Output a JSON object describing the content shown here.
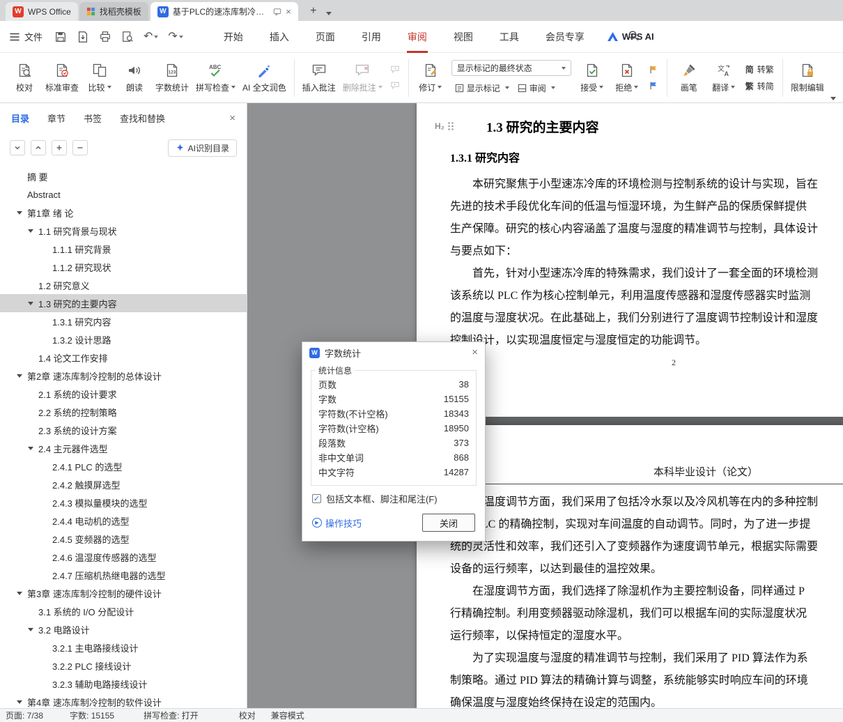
{
  "window": {
    "tab_wps": "WPS Office",
    "tab_template": "找稻壳模板",
    "tab_document": "基于PLC的速冻库制冷控制系...",
    "file_menu": "文件",
    "menu_tabs": [
      "开始",
      "插入",
      "页面",
      "引用",
      "审阅",
      "视图",
      "工具",
      "会员专享"
    ],
    "wps_ai": "WPS AI"
  },
  "icons": {
    "w": "W",
    "h2": "H₂",
    "jian": "简",
    "fan": "繁"
  },
  "ribbon": {
    "proofread": "校对",
    "standard_review": "标准审查",
    "compare": "比较",
    "read_aloud": "朗读",
    "word_count": "字数统计",
    "spell_check": "拼写检查",
    "ai_polish": "AI 全文润色",
    "insert_comment": "插入批注",
    "delete_comment": "删除批注",
    "track_changes": "修订",
    "markup_state": "显示标记的最终状态",
    "show_markup": "显示标记",
    "review_pane": "审阅",
    "accept": "接受",
    "reject": "拒绝",
    "brush": "画笔",
    "translate": "翻译",
    "to_traditional": "转繁",
    "to_simplified": "转简",
    "restrict_edit": "限制编辑"
  },
  "sidebar": {
    "tabs": [
      "目录",
      "章节",
      "书签",
      "查找和替换"
    ],
    "ai_toc": "AI识别目录",
    "toc": [
      {
        "level": 0,
        "label": "摘  要"
      },
      {
        "level": 0,
        "label": "Abstract"
      },
      {
        "level": 0,
        "label": "第1章 绪  论",
        "arrow": true
      },
      {
        "level": 1,
        "label": "1.1 研究背景与现状",
        "arrow": true
      },
      {
        "level": 2,
        "label": "1.1.1 研究背景"
      },
      {
        "level": 2,
        "label": "1.1.2 研究现状"
      },
      {
        "level": 1,
        "label": "1.2 研究意义"
      },
      {
        "level": 1,
        "label": "1.3 研究的主要内容",
        "arrow": true,
        "selected": true
      },
      {
        "level": 2,
        "label": "1.3.1 研究内容"
      },
      {
        "level": 2,
        "label": "1.3.2 设计思路"
      },
      {
        "level": 1,
        "label": "1.4 论文工作安排"
      },
      {
        "level": 0,
        "label": "第2章 速冻库制冷控制的总体设计",
        "arrow": true
      },
      {
        "level": 1,
        "label": "2.1 系统的设计要求"
      },
      {
        "level": 1,
        "label": "2.2 系统的控制策略"
      },
      {
        "level": 1,
        "label": "2.3 系统的设计方案"
      },
      {
        "level": 1,
        "label": "2.4 主元器件选型",
        "arrow": true
      },
      {
        "level": 2,
        "label": "2.4.1 PLC 的选型"
      },
      {
        "level": 2,
        "label": "2.4.2 触摸屏选型"
      },
      {
        "level": 2,
        "label": "2.4.3 模拟量模块的选型"
      },
      {
        "level": 2,
        "label": "2.4.4 电动机的选型"
      },
      {
        "level": 2,
        "label": "2.4.5 变频器的选型"
      },
      {
        "level": 2,
        "label": "2.4.6 温湿度传感器的选型"
      },
      {
        "level": 2,
        "label": "2.4.7 压缩机热继电器的选型"
      },
      {
        "level": 0,
        "label": "第3章 速冻库制冷控制的硬件设计",
        "arrow": true
      },
      {
        "level": 1,
        "label": "3.1 系统的 I/O 分配设计"
      },
      {
        "level": 1,
        "label": "3.2 电路设计",
        "arrow": true
      },
      {
        "level": 2,
        "label": "3.2.1 主电路接线设计"
      },
      {
        "level": 2,
        "label": "3.2.2 PLC 接线设计"
      },
      {
        "level": 2,
        "label": "3.2.3 辅助电路接线设计"
      },
      {
        "level": 0,
        "label": "第4章 速冻库制冷控制的软件设计",
        "arrow": true
      }
    ]
  },
  "document": {
    "page1": {
      "heading2": "1.3  研究的主要内容",
      "heading3": "1.3.1 研究内容",
      "lines": [
        "　　本研究聚焦于小型速冻冷库的环境检测与控制系统的设计与实现，旨在",
        "先进的技术手段优化车间的低温与恒湿环境，为生鲜产品的保质保鲜提供",
        "生产保障。研究的核心内容涵盖了温度与湿度的精准调节与控制，具体设计",
        "与要点如下：",
        "　　首先，针对小型速冻冷库的特殊需求，我们设计了一套全面的环境检测",
        "该系统以 PLC 作为核心控制单元，利用温度传感器和湿度传感器实时监测",
        "的温度与湿度状况。在此基础上，我们分别进行了温度调节控制设计和湿度",
        "控制设计，以实现温度恒定与湿度恒定的功能调节。"
      ],
      "page_number": "2"
    },
    "page2": {
      "header": "本科毕业设计（论文）",
      "lines": [
        "　　在温度调节方面，我们采用了包括冷水泵以及冷风机等在内的多种控制",
        "通过 PLC 的精确控制，实现对车间温度的自动调节。同时，为了进一步提",
        "统的灵活性和效率，我们还引入了变频器作为速度调节单元，根据实际需要",
        "设备的运行频率，以达到最佳的温控效果。",
        "　　在湿度调节方面，我们选择了除湿机作为主要控制设备，同样通过 P",
        "行精确控制。利用变频器驱动除湿机，我们可以根据车间的实际湿度状况",
        "运行频率，以保持恒定的湿度水平。",
        "　　为了实现温度与湿度的精准调节与控制，我们采用了 PID 算法作为系",
        "制策略。通过 PID 算法的精确计算与调整，系统能够实时响应车间的环境",
        "确保温度与湿度始终保持在设定的范围内。"
      ]
    }
  },
  "dialog": {
    "title": "字数统计",
    "group": "统计信息",
    "stats": [
      {
        "label": "页数",
        "value": "38"
      },
      {
        "label": "字数",
        "value": "15155"
      },
      {
        "label": "字符数(不计空格)",
        "value": "18343"
      },
      {
        "label": "字符数(计空格)",
        "value": "18950"
      },
      {
        "label": "段落数",
        "value": "373"
      },
      {
        "label": "非中文单词",
        "value": "868"
      },
      {
        "label": "中文字符",
        "value": "14287"
      }
    ],
    "checkbox": "包括文本框、脚注和尾注(F)",
    "tips": "操作技巧",
    "close": "关闭"
  },
  "statusbar": {
    "page": "页面: 7/38",
    "words": "字数: 15155",
    "spell": "拼写检查: 打开",
    "proof": "校对",
    "compat": "兼容模式"
  }
}
